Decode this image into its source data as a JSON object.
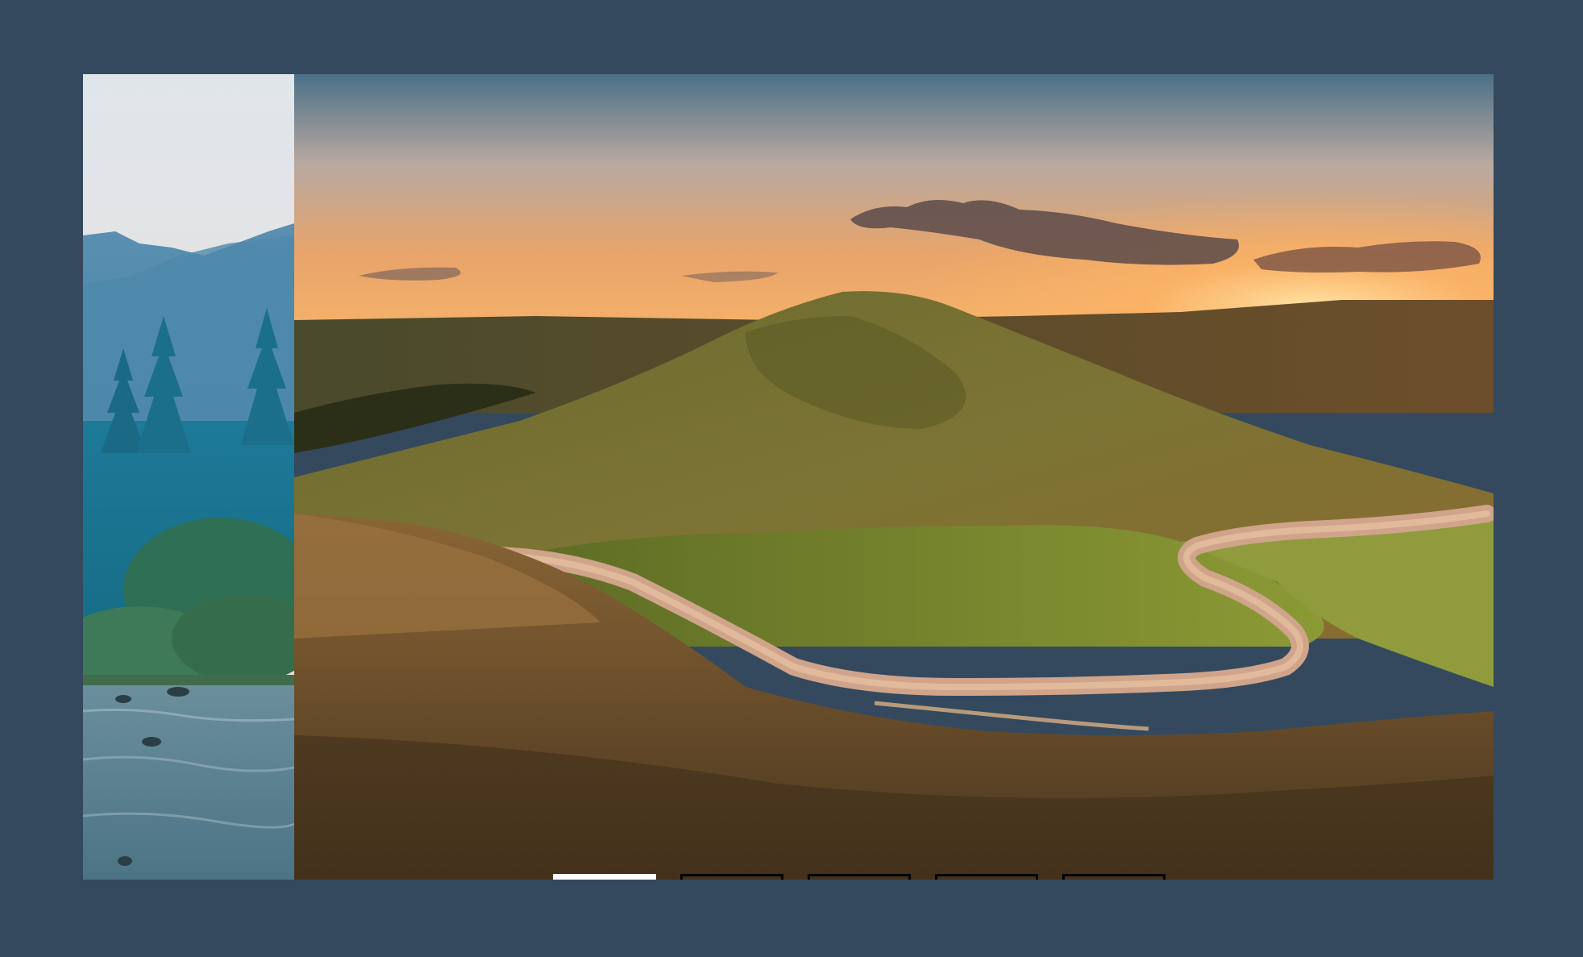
{
  "carousel": {
    "slides": [
      {
        "name": "forest-river",
        "icon": "landscape-image"
      },
      {
        "name": "hill-road-sunset",
        "icon": "landscape-image"
      }
    ],
    "indicators": [
      {
        "active": true
      },
      {
        "active": false
      },
      {
        "active": false
      },
      {
        "active": false
      },
      {
        "active": false
      }
    ],
    "active_index": 0,
    "colors": {
      "background": "#34495e",
      "indicator_active": "#ffffff",
      "indicator_inactive_border": "#000000"
    }
  }
}
